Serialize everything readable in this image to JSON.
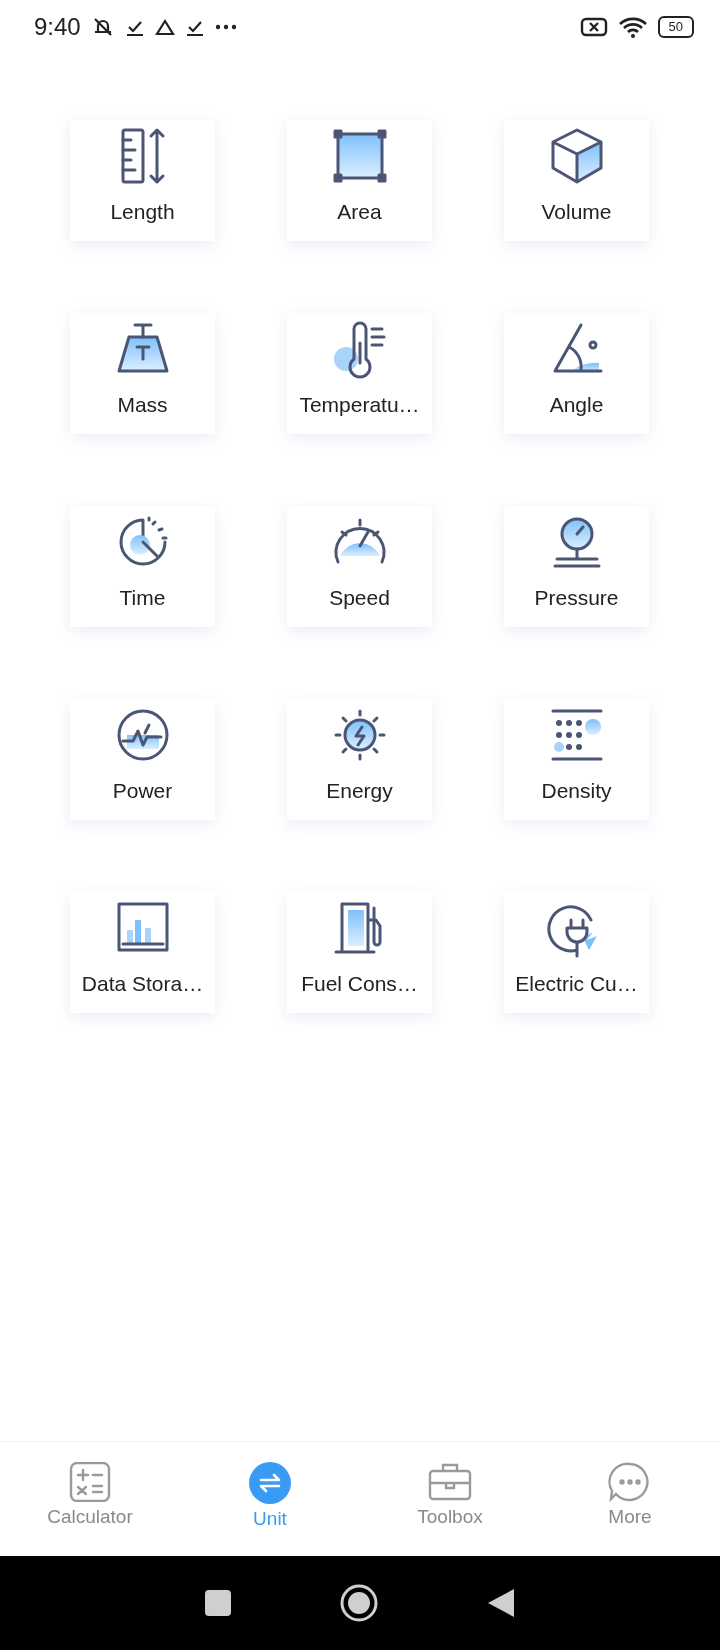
{
  "status_bar": {
    "time": "9:40",
    "battery": "50"
  },
  "categories": [
    {
      "label": "Length"
    },
    {
      "label": "Area"
    },
    {
      "label": "Volume"
    },
    {
      "label": "Mass"
    },
    {
      "label": "Temperatu…"
    },
    {
      "label": "Angle"
    },
    {
      "label": "Time"
    },
    {
      "label": "Speed"
    },
    {
      "label": "Pressure"
    },
    {
      "label": "Power"
    },
    {
      "label": "Energy"
    },
    {
      "label": "Density"
    },
    {
      "label": "Data Stora…"
    },
    {
      "label": "Fuel Cons…"
    },
    {
      "label": "Electric Cu…"
    }
  ],
  "nav": [
    {
      "label": "Calculator",
      "selected": false
    },
    {
      "label": "Unit",
      "selected": true
    },
    {
      "label": "Toolbox",
      "selected": false
    },
    {
      "label": "More",
      "selected": false
    }
  ]
}
